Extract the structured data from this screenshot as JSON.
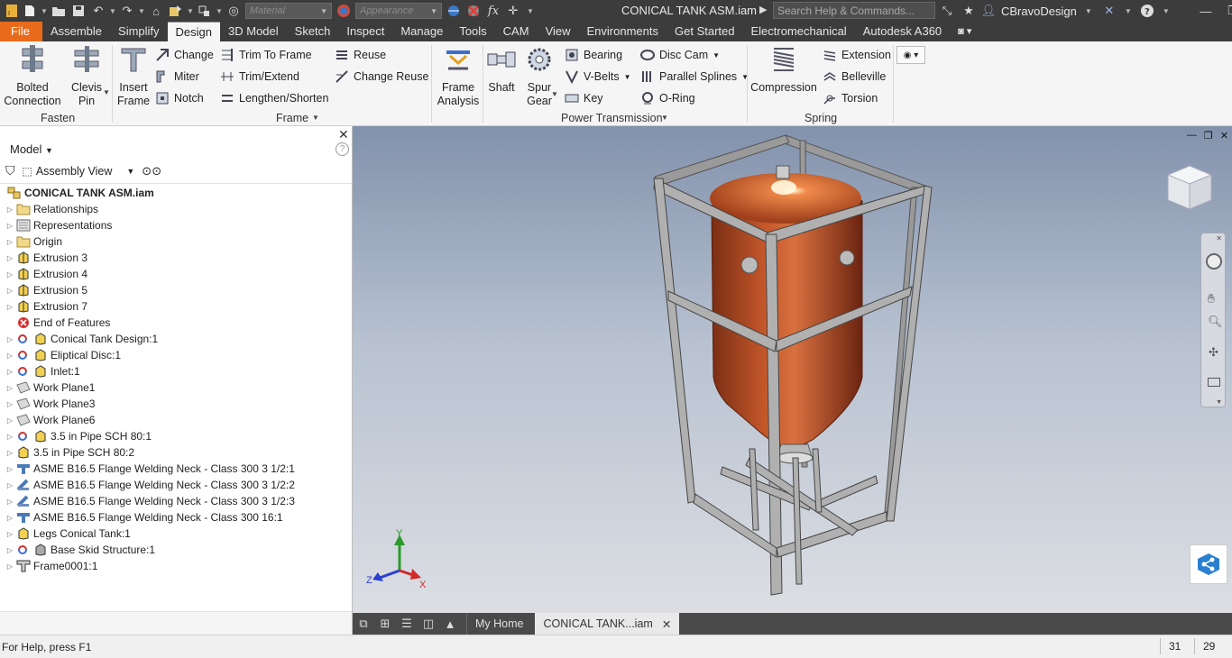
{
  "app": {
    "title": "CONICAL TANK ASM.iam",
    "search_placeholder": "Search Help & Commands...",
    "user": "CBravoDesign",
    "material_placeholder": "Material",
    "appearance_placeholder": "Appearance"
  },
  "tabs": [
    "File",
    "Assemble",
    "Simplify",
    "Design",
    "3D Model",
    "Sketch",
    "Inspect",
    "Manage",
    "Tools",
    "CAM",
    "View",
    "Environments",
    "Get Started",
    "Electromechanical",
    "Autodesk A360"
  ],
  "active_tab": "Design",
  "ribbon": {
    "fasten": {
      "title": "Fasten",
      "bolted": "Bolted\nConnection",
      "clevis": "Clevis\nPin"
    },
    "frame": {
      "title": "Frame",
      "insert": "Insert\nFrame",
      "change": "Change",
      "miter": "Miter",
      "notch": "Notch",
      "trim_to_frame": "Trim To Frame",
      "trim_extend": "Trim/Extend",
      "lengthen": "Lengthen/Shorten",
      "reuse": "Reuse",
      "change_reuse": "Change Reuse"
    },
    "frame_analysis": "Frame\nAnalysis",
    "power": {
      "title": "Power Transmission",
      "shaft": "Shaft",
      "spur_gear": "Spur\nGear",
      "bearing": "Bearing",
      "vbelts": "V-Belts",
      "key": "Key",
      "disc_cam": "Disc Cam",
      "parallel_splines": "Parallel Splines",
      "oring": "O-Ring"
    },
    "spring": {
      "title": "Spring",
      "compression": "Compression",
      "extension": "Extension",
      "belleville": "Belleville",
      "torsion": "Torsion"
    }
  },
  "browser": {
    "title": "Model",
    "view": "Assembly View",
    "help": "?",
    "root": "CONICAL TANK ASM.iam",
    "items": [
      {
        "label": "Relationships",
        "icon": "folder"
      },
      {
        "label": "Representations",
        "icon": "representations"
      },
      {
        "label": "Origin",
        "icon": "folder"
      },
      {
        "label": "Extrusion 3",
        "icon": "extrusion"
      },
      {
        "label": "Extrusion 4",
        "icon": "extrusion"
      },
      {
        "label": "Extrusion 5",
        "icon": "extrusion"
      },
      {
        "label": "Extrusion 7",
        "icon": "extrusion"
      },
      {
        "label": "End of Features",
        "icon": "end"
      },
      {
        "label": "Conical Tank Design:1",
        "icon": "adaptive-part"
      },
      {
        "label": "Eliptical Disc:1",
        "icon": "adaptive-part"
      },
      {
        "label": "Inlet:1",
        "icon": "adaptive-part"
      },
      {
        "label": "Work Plane1",
        "icon": "workplane"
      },
      {
        "label": "Work Plane3",
        "icon": "workplane"
      },
      {
        "label": "Work Plane6",
        "icon": "workplane"
      },
      {
        "label": "3.5 in Pipe SCH 80:1",
        "icon": "adaptive-part"
      },
      {
        "label": "3.5 in Pipe SCH 80:2",
        "icon": "part"
      },
      {
        "label": "ASME B16.5 Flange Welding Neck - Class 300 3 1/2:1",
        "icon": "flange"
      },
      {
        "label": "ASME B16.5 Flange Welding Neck - Class 300 3 1/2:2",
        "icon": "flange-alt"
      },
      {
        "label": "ASME B16.5 Flange Welding Neck - Class 300 3 1/2:3",
        "icon": "flange-alt"
      },
      {
        "label": "ASME B16.5 Flange Welding Neck - Class 300 16:1",
        "icon": "flange"
      },
      {
        "label": "Legs Conical Tank:1",
        "icon": "part"
      },
      {
        "label": "Base Skid Structure:1",
        "icon": "adaptive-assembly"
      },
      {
        "label": "Frame0001:1",
        "icon": "frame"
      }
    ]
  },
  "doc_tabs": {
    "home": "My Home",
    "active": "CONICAL TANK...iam"
  },
  "axes": {
    "x": "X",
    "y": "Y",
    "z": "Z"
  },
  "status": {
    "help": "For Help, press F1",
    "n1": "31",
    "n2": "29"
  }
}
